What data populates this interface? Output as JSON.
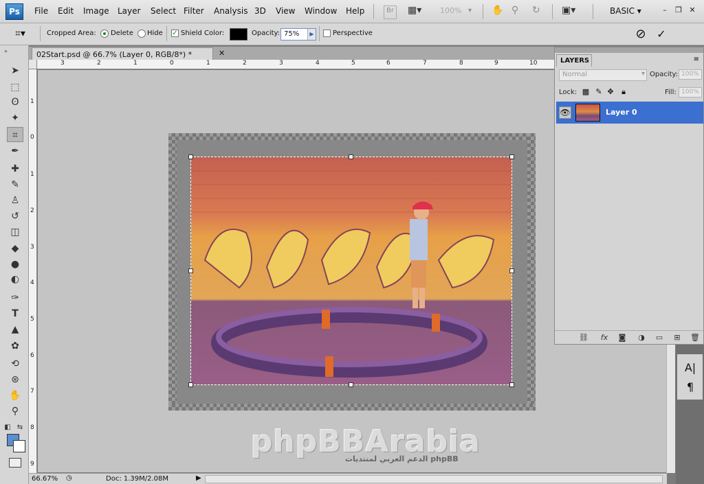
{
  "app": {
    "logo": "Ps",
    "menu": [
      "File",
      "Edit",
      "Image",
      "Layer",
      "Select",
      "Filter",
      "Analysis",
      "3D",
      "View",
      "Window",
      "Help"
    ],
    "bridge_button": "Br",
    "zoom_level": "100%",
    "workspace": "BASIC"
  },
  "options_bar": {
    "cropped_area_label": "Cropped Area:",
    "delete_label": "Delete",
    "hide_label": "Hide",
    "cropped_area_selected": "Delete",
    "shield_label": "Shield",
    "shield_checked": true,
    "color_label": "Color:",
    "shield_color": "#000000",
    "opacity_label": "Opacity:",
    "opacity_value": "75%",
    "perspective_label": "Perspective",
    "perspective_checked": false
  },
  "document": {
    "tab_title": "02Start.psd @ 66.7% (Layer 0, RGB/8*) *",
    "ruler_top_labels": [
      "3",
      "2",
      "1",
      "0",
      "1",
      "2",
      "3",
      "4",
      "5",
      "6",
      "7",
      "8",
      "9",
      "10"
    ],
    "ruler_left_labels": [
      "1",
      "0",
      "1",
      "2",
      "3",
      "4",
      "5",
      "6",
      "7",
      "8",
      "9"
    ]
  },
  "status_bar": {
    "zoom": "66.67%",
    "doc_size": "Doc: 1.39M/2.08M"
  },
  "layers_panel": {
    "title": "LAYERS",
    "blend_mode": "Normal",
    "opacity_label": "Opacity:",
    "opacity_value": "100%",
    "lock_label": "Lock:",
    "fill_label": "Fill:",
    "fill_value": "100%",
    "layers": [
      {
        "name": "Layer 0",
        "visible": true,
        "selected": true
      }
    ]
  },
  "watermark": {
    "text": "phpBBArabia",
    "subtext": "الدعم العربي لمنتديات phpBB"
  },
  "colors": {
    "foreground": "#5a8fd0",
    "background": "#ffffff",
    "selection": "#3b6fd0"
  }
}
